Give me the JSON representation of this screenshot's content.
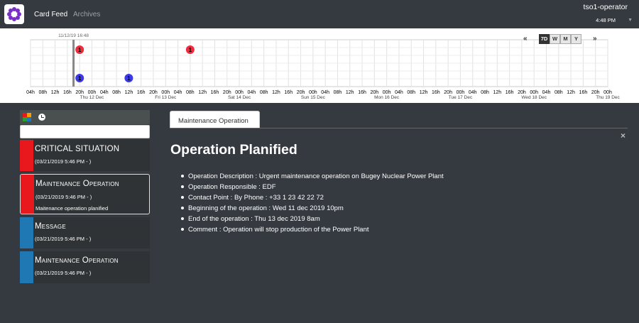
{
  "nav": {
    "links": [
      "Card Feed",
      "Archives"
    ],
    "user": "tso1-operator",
    "time": "4:48 PM"
  },
  "timeline": {
    "current_time_label": "11/12/19 16:48",
    "periods": [
      "7D",
      "W",
      "M",
      "Y"
    ],
    "selected_period": "7D",
    "prev_label": "«",
    "next_label": "»",
    "hour_ticks": [
      "04h",
      "08h",
      "12h",
      "16h",
      "20h",
      "00h",
      "04h",
      "08h",
      "12h",
      "16h",
      "20h",
      "00h",
      "04h",
      "08h",
      "12h",
      "16h",
      "20h",
      "00h",
      "04h",
      "08h",
      "12h",
      "16h",
      "20h",
      "00h",
      "04h",
      "08h",
      "12h",
      "16h",
      "20h",
      "00h",
      "04h",
      "08h",
      "12h",
      "16h",
      "20h",
      "00h",
      "04h",
      "08h",
      "12h",
      "16h",
      "20h",
      "00h",
      "04h",
      "08h",
      "12h",
      "16h",
      "20h",
      "00h"
    ],
    "day_labels": [
      "Thu 12 Dec",
      "Fri 13 Dec",
      "Sat 14 Dec",
      "Sun 15 Dec",
      "Mon 16 Dec",
      "Tue 17 Dec",
      "Wed 18 Dec",
      "Thu 19 Dec"
    ],
    "bubbles": [
      {
        "row": "top",
        "color": "#ef2b3c",
        "count": "1",
        "slot": 4
      },
      {
        "row": "top",
        "color": "#ef2b3c",
        "count": "1",
        "slot": 13
      },
      {
        "row": "bottom",
        "color": "#3a3ae8",
        "count": "1",
        "slot": 4
      },
      {
        "row": "bottom",
        "color": "#3a3ae8",
        "count": "1",
        "slot": 8
      }
    ]
  },
  "feed": {
    "filter_icon": "filter-icon",
    "clock_icon": "clock-icon",
    "cards": [
      {
        "title": "CRITICAL SITUATION",
        "date": "(03/21/2019 5:46 PM - )",
        "summary": "",
        "color": "#e8181d",
        "selected": false
      },
      {
        "title": "Maintenance Operation",
        "date": "(03/21/2019 5:46 PM - )",
        "summary": "Maitenance operation planified",
        "color": "#e8181d",
        "selected": true
      },
      {
        "title": "Message",
        "date": "(03/21/2019 5:46 PM - )",
        "summary": "",
        "color": "#1f77b4",
        "selected": false
      },
      {
        "title": "Maintenance Operation",
        "date": "(03/21/2019 5:46 PM - )",
        "summary": "",
        "color": "#1f77b4",
        "selected": false
      }
    ]
  },
  "detail": {
    "tab": "Maintenance Operation",
    "close": "×",
    "title": "Operation Planified",
    "items": [
      "Operation Description : Urgent maintenance operation on Bugey Nuclear Power Plant",
      "Operation Responsible : EDF",
      "Contact Point : By Phone : +33 1 23 42 22 72",
      "Beginning of the operation : Wed 11 dec 2019 10pm",
      "End of the operation : Thu 13 dec 2019 8am",
      "Comment : Operation will stop production of the Power Plant"
    ]
  }
}
